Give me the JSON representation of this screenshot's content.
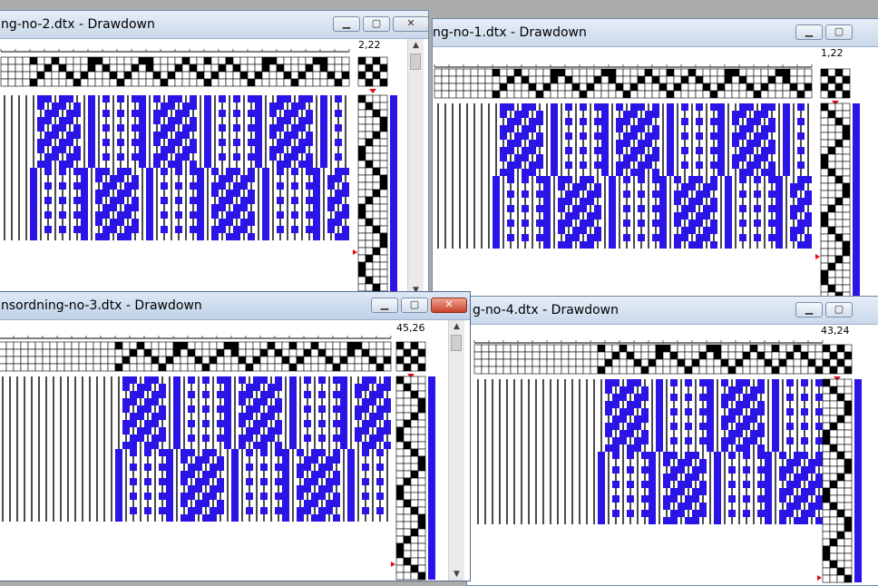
{
  "colors": {
    "desktop": "#ababab",
    "warp_weft_blue": "#2a14e6",
    "grid": "#000000",
    "marker": "#e01010",
    "close_active": "#c8432b"
  },
  "icons": {
    "minimize": "minimize-icon",
    "maximize": "maximize-icon",
    "close": "close-icon",
    "scroll_up": "chevron-up-icon",
    "scroll_down": "chevron-down-icon",
    "marker": "triangle-marker-icon"
  },
  "windows": [
    {
      "id": "w1",
      "title": "ng-no-1.dtx - Drawdown",
      "position_label": "1,22",
      "active": false
    },
    {
      "id": "w2",
      "title": "ng-no-2.dtx - Drawdown",
      "position_label": "2,22",
      "active": false
    },
    {
      "id": "w4",
      "title": "g-no-4.dtx - Drawdown",
      "position_label": "43,24",
      "active": false
    },
    {
      "id": "w3",
      "title": "nsordning-no-3.dtx - Drawdown",
      "position_label": "45,26",
      "active": true
    }
  ],
  "controls": {
    "minimize": "▁",
    "maximize": "▢",
    "close": "✕"
  }
}
